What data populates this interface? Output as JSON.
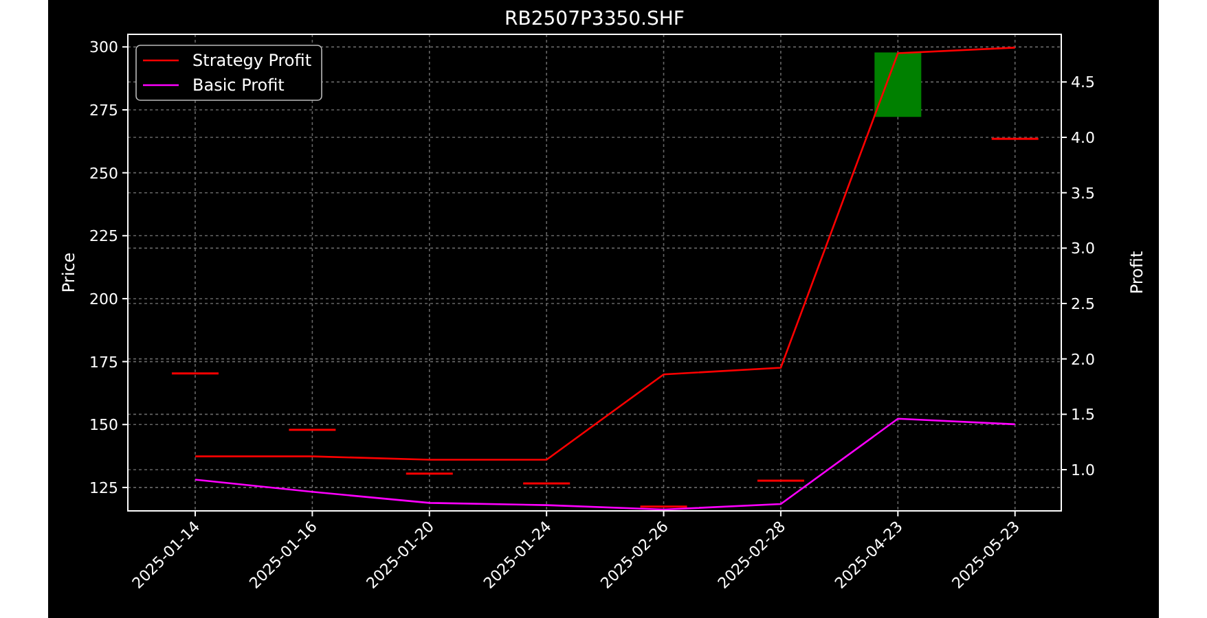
{
  "chart": {
    "chart_data": {
      "type": "line",
      "title": "RB2507P3350.SHF",
      "ylabel": "Price",
      "y2label": "Profit",
      "grid": true,
      "legend": true,
      "categories": [
        "2025-01-14",
        "2025-01-16",
        "2025-01-20",
        "2025-01-24",
        "2025-02-26",
        "2025-02-28",
        "2025-04-23",
        "2025-05-23"
      ],
      "ylim": [
        115.7,
        305
      ],
      "yticks": [
        125,
        150,
        175,
        200,
        225,
        250,
        275,
        300
      ],
      "y2lim": [
        0.628,
        4.93
      ],
      "y2ticks": [
        {
          "value": 1,
          "label": "1.0"
        },
        1.5,
        {
          "value": 2,
          "label": "2.0"
        },
        2.5,
        {
          "value": 3,
          "label": "3.0"
        },
        3.5,
        {
          "value": 4,
          "label": "4.0"
        },
        4.5
      ],
      "series": [
        {
          "name": "Strategy Profit",
          "color": "#ff0000",
          "axis": "y2",
          "values": [
            1.12,
            1.12,
            1.09,
            1.09,
            1.86,
            1.92,
            4.76,
            4.81
          ]
        },
        {
          "name": "Basic Profit",
          "color": "#ff00ff",
          "axis": "y2",
          "values": [
            0.91,
            0.8,
            0.7,
            0.68,
            0.64,
            0.69,
            1.46,
            1.41
          ]
        },
        {
          "type": "bar",
          "color": "#ff0000",
          "base": [
            170.3,
            147.9,
            130.5,
            126.6,
            117.4,
            127.7,
            null,
            263.5
          ],
          "values": [
            0,
            0,
            0,
            0,
            0,
            0,
            null,
            0
          ]
        },
        {
          "type": "bar",
          "color": "#008000",
          "base": [
            null,
            null,
            null,
            null,
            null,
            null,
            272.2,
            null
          ],
          "values": [
            null,
            null,
            null,
            null,
            null,
            null,
            25.6,
            null
          ]
        }
      ]
    }
  }
}
